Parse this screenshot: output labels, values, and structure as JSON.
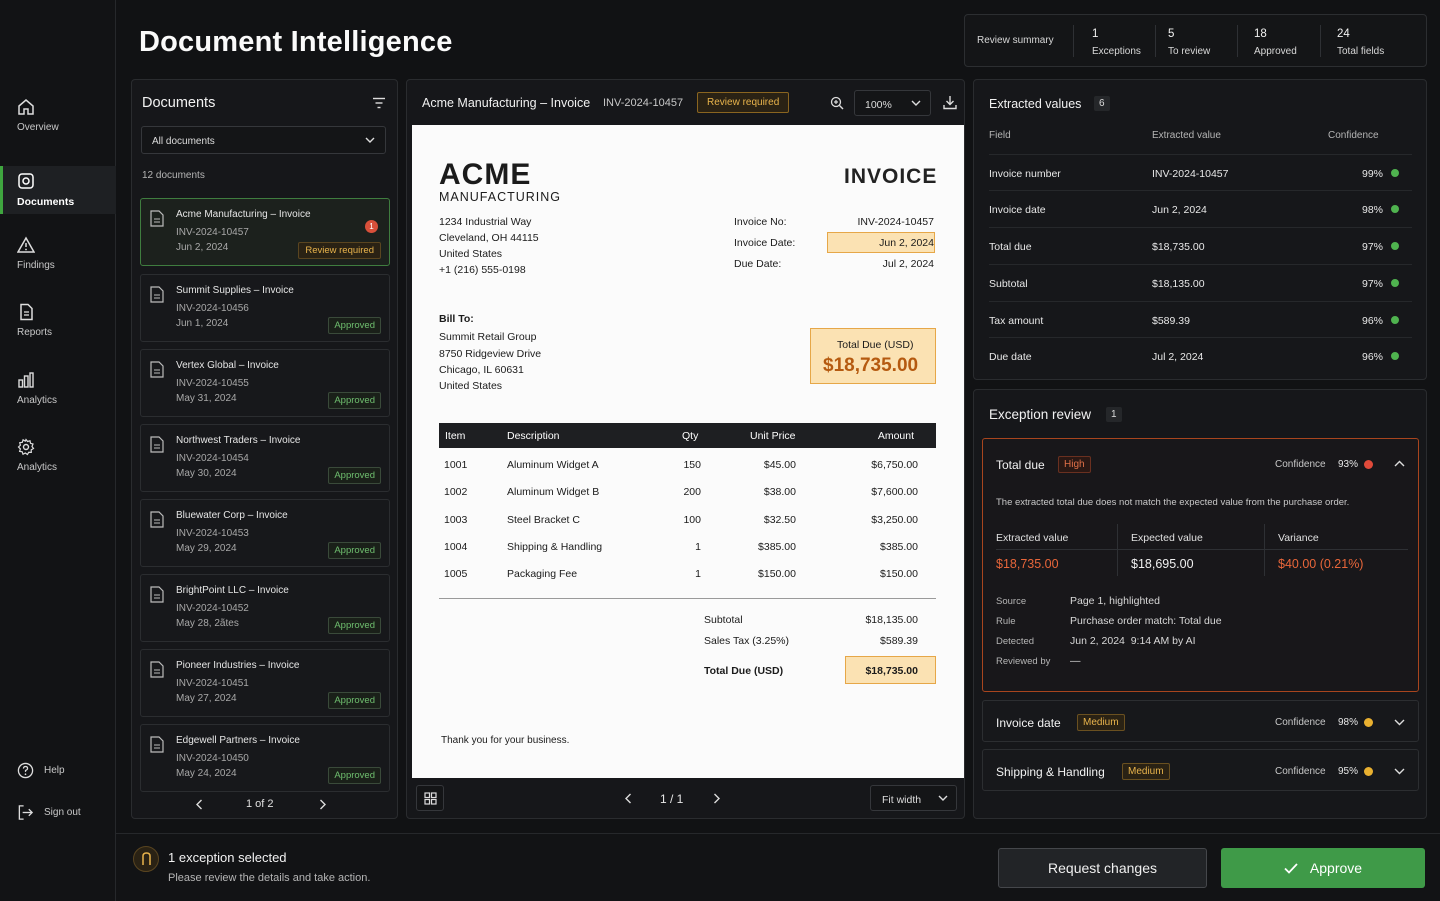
{
  "sidebar": {
    "items": [
      {
        "label": "Overview",
        "icon": "home-icon"
      },
      {
        "label": "Documents",
        "icon": "documents-icon"
      },
      {
        "label": "Findings",
        "icon": "warning-icon"
      },
      {
        "label": "Reports",
        "icon": "report-icon"
      },
      {
        "label": "Analytics",
        "icon": "chart-icon"
      },
      {
        "label": "Analytics",
        "icon": "gear-icon"
      }
    ],
    "help": "Help",
    "signout": "Sign out"
  },
  "header": {
    "title": "Document Intelligence",
    "summary_label": "Review summary",
    "stats": [
      {
        "value": "1",
        "label": "Exceptions"
      },
      {
        "value": "5",
        "label": "To review"
      },
      {
        "value": "18",
        "label": "Approved"
      },
      {
        "value": "24",
        "label": "Total fields"
      }
    ]
  },
  "documents": {
    "title": "Documents",
    "filter": "All documents",
    "count": "12 documents",
    "items": [
      {
        "title": "Acme Manufacturing – Invoice",
        "number": "INV-2024-10457",
        "date": "Jun 2, 2024",
        "status": "Review required",
        "alert": "1"
      },
      {
        "title": "Summit Supplies – Invoice",
        "number": "INV-2024-10456",
        "date": "Jun 1, 2024",
        "status": "Approved"
      },
      {
        "title": "Vertex Global – Invoice",
        "number": "INV-2024-10455",
        "date": "May 31, 2024",
        "status": "Approved"
      },
      {
        "title": "Northwest Traders – Invoice",
        "number": "INV-2024-10454",
        "date": "May 30, 2024",
        "status": "Approved"
      },
      {
        "title": "Bluewater Corp – Invoice",
        "number": "INV-2024-10453",
        "date": "May 29, 2024",
        "status": "Approved"
      },
      {
        "title": "BrightPoint LLC – Invoice",
        "number": "INV-2024-10452",
        "date": "May 28, 2ãtes",
        "status": "Approved"
      },
      {
        "title": "Pioneer Industries – Invoice",
        "number": "INV-2024-10451",
        "date": "May 27, 2024",
        "status": "Approved"
      },
      {
        "title": "Edgewell Partners – Invoice",
        "number": "INV-2024-10450",
        "date": "May 24, 2024",
        "status": "Approved"
      }
    ],
    "pager": "1 of 2"
  },
  "viewer": {
    "doc_title": "Acme Manufacturing – Invoice",
    "doc_number": "INV-2024-10457",
    "status": "Review required",
    "zoom": "100%",
    "page": "1 / 1",
    "fit": "Fit width"
  },
  "invoice": {
    "company": "ACME",
    "company_sub": "MANUFACTURING",
    "heading": "INVOICE",
    "address": [
      "1234 Industrial Way",
      "Cleveland, OH 44115",
      "United States",
      "+1 (216) 555-0198"
    ],
    "meta": [
      {
        "label": "Invoice No:",
        "value": "INV-2024-10457"
      },
      {
        "label": "Invoice Date:",
        "value": "Jun 2, 2024"
      },
      {
        "label": "Due Date:",
        "value": "Jul 2, 2024"
      }
    ],
    "bill_to_label": "Bill To:",
    "bill_to": [
      "Summit Retail Group",
      "8750 Ridgeview Drive",
      "Chicago, IL 60631",
      "United States"
    ],
    "total_box_label": "Total Due (USD)",
    "total_box_value": "$18,735.00",
    "columns": [
      "Item",
      "Description",
      "Qty",
      "Unit Price",
      "Amount"
    ],
    "rows": [
      [
        "1001",
        "Aluminum Widget A",
        "150",
        "$45.00",
        "$6,750.00"
      ],
      [
        "1002",
        "Aluminum Widget B",
        "200",
        "$38.00",
        "$7,600.00"
      ],
      [
        "1003",
        "Steel Bracket C",
        "100",
        "$32.50",
        "$3,250.00"
      ],
      [
        "1004",
        "Shipping & Handling",
        "1",
        "$385.00",
        "$385.00"
      ],
      [
        "1005",
        "Packaging Fee",
        "1",
        "$150.00",
        "$150.00"
      ]
    ],
    "subtotal_label": "Subtotal",
    "subtotal": "$18,135.00",
    "tax_label": "Sales Tax (3.25%)",
    "tax": "$589.39",
    "total_label": "Total Due (USD)",
    "total": "$18,735.00",
    "thanks": "Thank you for your business."
  },
  "extracted": {
    "title": "Extracted values",
    "count": "6",
    "headers": [
      "Field",
      "Extracted value",
      "Confidence"
    ],
    "rows": [
      {
        "field": "Invoice number",
        "value": "INV-2024-10457",
        "conf": "99%"
      },
      {
        "field": "Invoice date",
        "value": "Jun 2, 2024",
        "conf": "98%"
      },
      {
        "field": "Total due",
        "value": "$18,735.00",
        "conf": "97%"
      },
      {
        "field": "Subtotal",
        "value": "$18,135.00",
        "conf": "97%"
      },
      {
        "field": "Tax amount",
        "value": "$589.39",
        "conf": "96%"
      },
      {
        "field": "Due date",
        "value": "Jul 2, 2024",
        "conf": "96%"
      }
    ]
  },
  "exceptions": {
    "title": "Exception review",
    "count": "1",
    "main": {
      "field": "Total due",
      "severity": "High",
      "conf_label": "Confidence",
      "conf": "93%",
      "message": "The extracted total due does not match the expected value from the purchase order.",
      "col1_label": "Extracted value",
      "col1_value": "$18,735.00",
      "col2_label": "Expected value",
      "col2_value": "$18,695.00",
      "col3_label": "Variance",
      "col3_value": "$40.00 (0.21%)",
      "details": [
        {
          "label": "Source",
          "value": "Page 1, highlighted"
        },
        {
          "label": "Rule",
          "value": "Purchase order match: Total due"
        },
        {
          "label": "Detected",
          "value": "Jun 2, 2024  9:14 AM by AI"
        },
        {
          "label": "Reviewed by",
          "value": "—"
        }
      ]
    },
    "others": [
      {
        "field": "Invoice date",
        "severity": "Medium",
        "conf_label": "Confidence",
        "conf": "98%"
      },
      {
        "field": "Shipping & Handling",
        "severity": "Medium",
        "conf_label": "Confidence",
        "conf": "95%"
      }
    ]
  },
  "footer": {
    "selected": "1 exception selected",
    "hint": "Please review the details and take action.",
    "request": "Request changes",
    "approve": "Approve"
  }
}
